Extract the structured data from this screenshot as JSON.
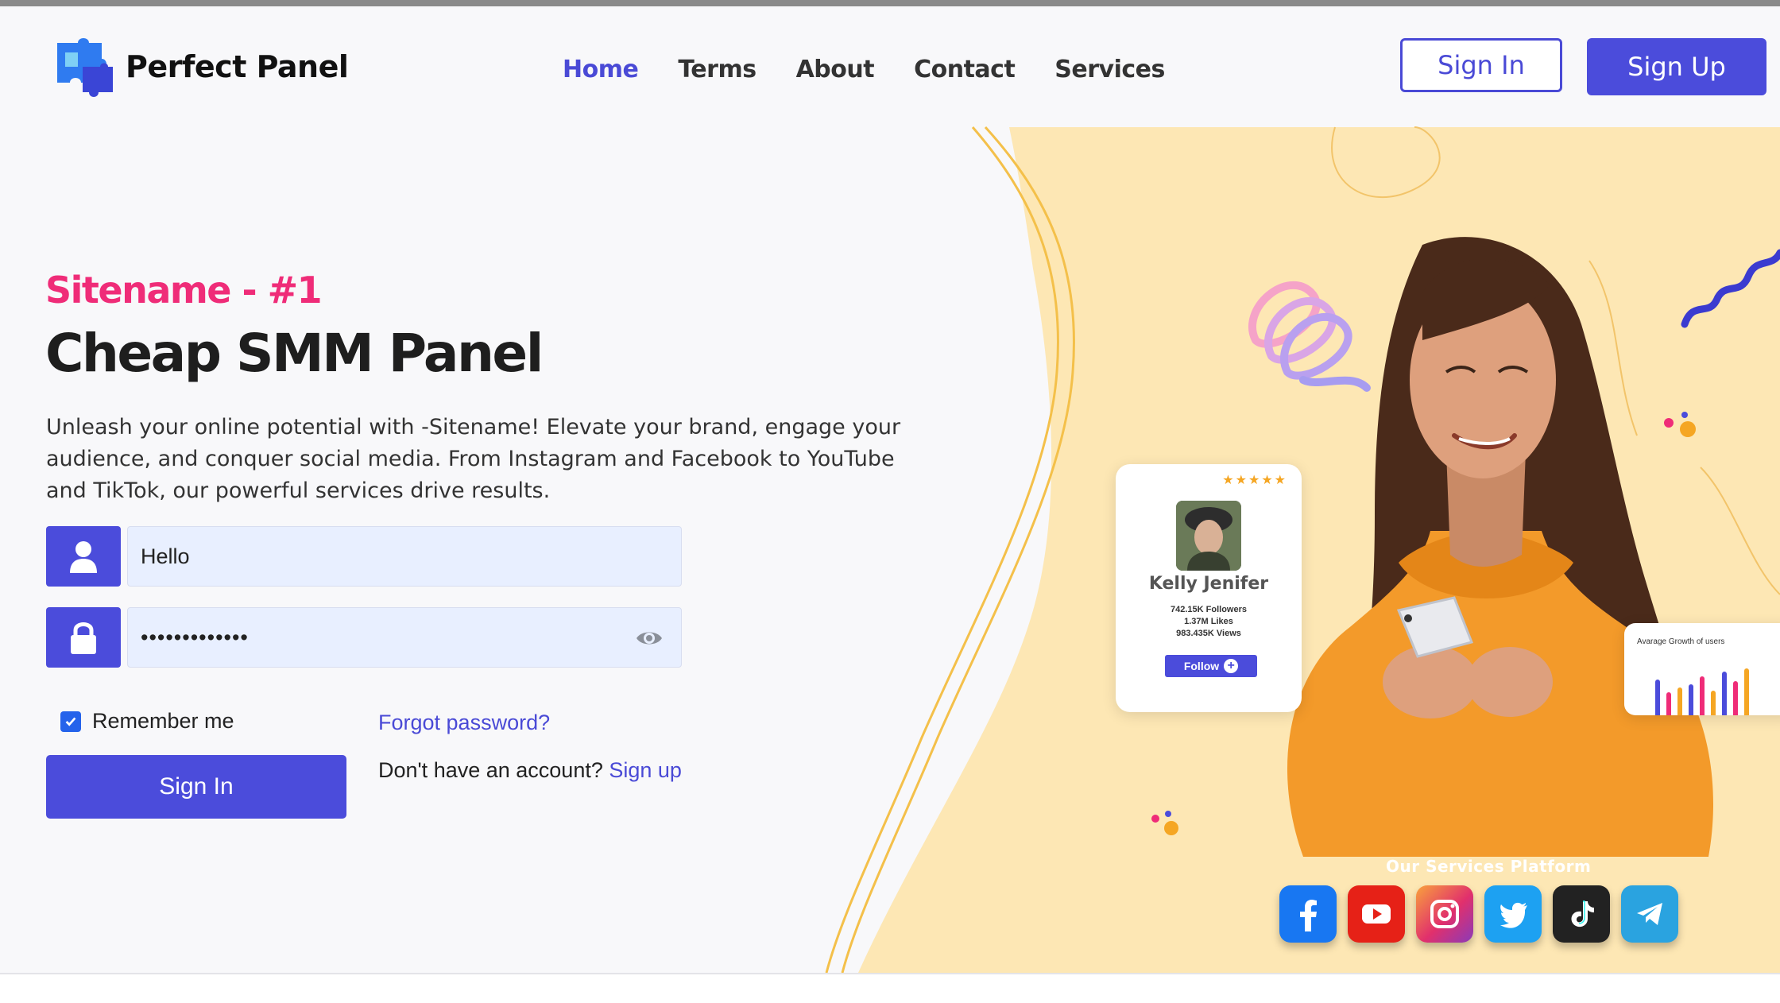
{
  "header": {
    "brand": "Perfect Panel",
    "nav": [
      {
        "label": "Home",
        "active": true
      },
      {
        "label": "Terms",
        "active": false
      },
      {
        "label": "About",
        "active": false
      },
      {
        "label": "Contact",
        "active": false
      },
      {
        "label": "Services",
        "active": false
      }
    ],
    "signin_label": "Sign In",
    "signup_label": "Sign Up"
  },
  "hero": {
    "tagline": "Sitename - #1",
    "headline": "Cheap SMM Panel",
    "description": "Unleash your online potential with -Sitename! Elevate your brand, engage your audience, and conquer social media. From Instagram and Facebook to YouTube and TikTok, our powerful services drive results."
  },
  "login_form": {
    "username_value": "Hello",
    "password_value": "•••••••••••••",
    "remember_label": "Remember me",
    "remember_checked": true,
    "forgot_label": "Forgot password?",
    "submit_label": "Sign In",
    "no_account_text": "Don't have an account?",
    "signup_link": "Sign up"
  },
  "profile_card": {
    "name": "Kelly Jenifer",
    "followers": "742.15K Followers",
    "likes": "1.37M Likes",
    "views": "983.435K Views",
    "follow_label": "Follow",
    "rating": 5
  },
  "growth_card": {
    "title": "Avarage Growth of users"
  },
  "services": {
    "title": "Our Services Platform",
    "platforms": [
      {
        "icon": "facebook-icon",
        "color": "#1877f2"
      },
      {
        "icon": "youtube-icon",
        "color": "#e62117"
      },
      {
        "icon": "instagram-icon",
        "color": "#e1306c"
      },
      {
        "icon": "twitter-icon",
        "color": "#1da1f2"
      },
      {
        "icon": "tiktok-icon",
        "color": "#222222"
      },
      {
        "icon": "telegram-icon",
        "color": "#2aa3e0"
      }
    ]
  },
  "colors": {
    "accent": "#4b4cdb",
    "tagline": "#ef2c78",
    "hero_bg": "#fde7b4",
    "hoodie": "#f39a2a"
  }
}
